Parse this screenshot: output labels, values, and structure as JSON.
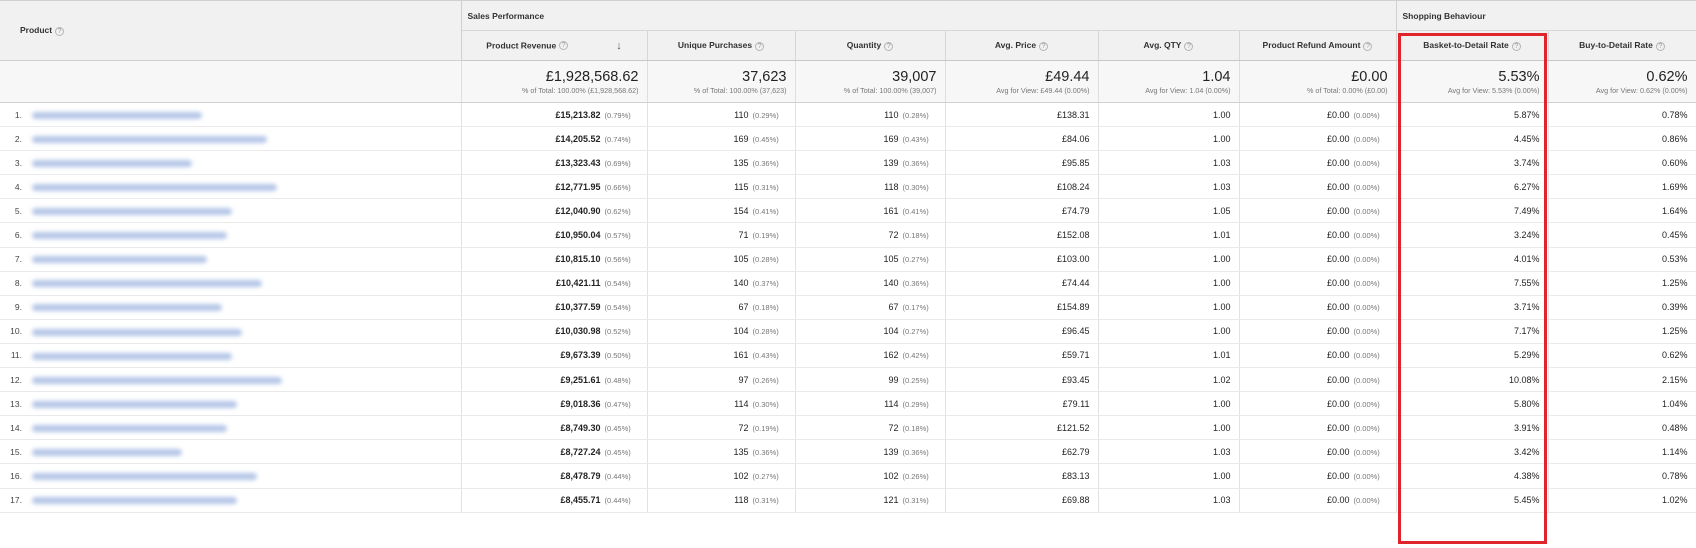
{
  "header": {
    "product_label": "Product",
    "group_sales": "Sales Performance",
    "group_shopping": "Shopping Behaviour",
    "columns": {
      "revenue": "Product Revenue",
      "unique": "Unique Purchases",
      "quantity": "Quantity",
      "avg_price": "Avg. Price",
      "avg_qty": "Avg. QTY",
      "refund": "Product Refund Amount",
      "b2d": "Basket-to-Detail Rate",
      "buy2d": "Buy-to-Detail Rate"
    }
  },
  "totals": {
    "revenue": {
      "value": "£1,928,568.62",
      "sub": "% of Total: 100.00% (£1,928,568.62)"
    },
    "unique": {
      "value": "37,623",
      "sub": "% of Total: 100.00% (37,623)"
    },
    "quantity": {
      "value": "39,007",
      "sub": "% of Total: 100.00% (39,007)"
    },
    "avg_price": {
      "value": "£49.44",
      "sub": "Avg for View: £49.44 (0.00%)"
    },
    "avg_qty": {
      "value": "1.04",
      "sub": "Avg for View: 1.04 (0.00%)"
    },
    "refund": {
      "value": "£0.00",
      "sub": "% of Total: 0.00% (£0.00)"
    },
    "b2d": {
      "value": "5.53%",
      "sub": "Avg for View: 5.53% (0.00%)"
    },
    "buy2d": {
      "value": "0.62%",
      "sub": "Avg for View: 0.62% (0.00%)"
    }
  },
  "rows": [
    {
      "idx": "1.",
      "revenue": "£15,213.82",
      "revenue_pct": "(0.79%)",
      "unique": "110",
      "unique_pct": "(0.29%)",
      "quantity": "110",
      "quantity_pct": "(0.28%)",
      "avg_price": "£138.31",
      "avg_qty": "1.00",
      "refund": "£0.00",
      "refund_pct": "(0.00%)",
      "b2d": "5.87%",
      "buy2d": "0.78%"
    },
    {
      "idx": "2.",
      "revenue": "£14,205.52",
      "revenue_pct": "(0.74%)",
      "unique": "169",
      "unique_pct": "(0.45%)",
      "quantity": "169",
      "quantity_pct": "(0.43%)",
      "avg_price": "£84.06",
      "avg_qty": "1.00",
      "refund": "£0.00",
      "refund_pct": "(0.00%)",
      "b2d": "4.45%",
      "buy2d": "0.86%"
    },
    {
      "idx": "3.",
      "revenue": "£13,323.43",
      "revenue_pct": "(0.69%)",
      "unique": "135",
      "unique_pct": "(0.36%)",
      "quantity": "139",
      "quantity_pct": "(0.36%)",
      "avg_price": "£95.85",
      "avg_qty": "1.03",
      "refund": "£0.00",
      "refund_pct": "(0.00%)",
      "b2d": "3.74%",
      "buy2d": "0.60%"
    },
    {
      "idx": "4.",
      "revenue": "£12,771.95",
      "revenue_pct": "(0.66%)",
      "unique": "115",
      "unique_pct": "(0.31%)",
      "quantity": "118",
      "quantity_pct": "(0.30%)",
      "avg_price": "£108.24",
      "avg_qty": "1.03",
      "refund": "£0.00",
      "refund_pct": "(0.00%)",
      "b2d": "6.27%",
      "buy2d": "1.69%"
    },
    {
      "idx": "5.",
      "revenue": "£12,040.90",
      "revenue_pct": "(0.62%)",
      "unique": "154",
      "unique_pct": "(0.41%)",
      "quantity": "161",
      "quantity_pct": "(0.41%)",
      "avg_price": "£74.79",
      "avg_qty": "1.05",
      "refund": "£0.00",
      "refund_pct": "(0.00%)",
      "b2d": "7.49%",
      "buy2d": "1.64%"
    },
    {
      "idx": "6.",
      "revenue": "£10,950.04",
      "revenue_pct": "(0.57%)",
      "unique": "71",
      "unique_pct": "(0.19%)",
      "quantity": "72",
      "quantity_pct": "(0.18%)",
      "avg_price": "£152.08",
      "avg_qty": "1.01",
      "refund": "£0.00",
      "refund_pct": "(0.00%)",
      "b2d": "3.24%",
      "buy2d": "0.45%"
    },
    {
      "idx": "7.",
      "revenue": "£10,815.10",
      "revenue_pct": "(0.56%)",
      "unique": "105",
      "unique_pct": "(0.28%)",
      "quantity": "105",
      "quantity_pct": "(0.27%)",
      "avg_price": "£103.00",
      "avg_qty": "1.00",
      "refund": "£0.00",
      "refund_pct": "(0.00%)",
      "b2d": "4.01%",
      "buy2d": "0.53%"
    },
    {
      "idx": "8.",
      "revenue": "£10,421.11",
      "revenue_pct": "(0.54%)",
      "unique": "140",
      "unique_pct": "(0.37%)",
      "quantity": "140",
      "quantity_pct": "(0.36%)",
      "avg_price": "£74.44",
      "avg_qty": "1.00",
      "refund": "£0.00",
      "refund_pct": "(0.00%)",
      "b2d": "7.55%",
      "buy2d": "1.25%"
    },
    {
      "idx": "9.",
      "revenue": "£10,377.59",
      "revenue_pct": "(0.54%)",
      "unique": "67",
      "unique_pct": "(0.18%)",
      "quantity": "67",
      "quantity_pct": "(0.17%)",
      "avg_price": "£154.89",
      "avg_qty": "1.00",
      "refund": "£0.00",
      "refund_pct": "(0.00%)",
      "b2d": "3.71%",
      "buy2d": "0.39%"
    },
    {
      "idx": "10.",
      "revenue": "£10,030.98",
      "revenue_pct": "(0.52%)",
      "unique": "104",
      "unique_pct": "(0.28%)",
      "quantity": "104",
      "quantity_pct": "(0.27%)",
      "avg_price": "£96.45",
      "avg_qty": "1.00",
      "refund": "£0.00",
      "refund_pct": "(0.00%)",
      "b2d": "7.17%",
      "buy2d": "1.25%"
    },
    {
      "idx": "11.",
      "revenue": "£9,673.39",
      "revenue_pct": "(0.50%)",
      "unique": "161",
      "unique_pct": "(0.43%)",
      "quantity": "162",
      "quantity_pct": "(0.42%)",
      "avg_price": "£59.71",
      "avg_qty": "1.01",
      "refund": "£0.00",
      "refund_pct": "(0.00%)",
      "b2d": "5.29%",
      "buy2d": "0.62%"
    },
    {
      "idx": "12.",
      "revenue": "£9,251.61",
      "revenue_pct": "(0.48%)",
      "unique": "97",
      "unique_pct": "(0.26%)",
      "quantity": "99",
      "quantity_pct": "(0.25%)",
      "avg_price": "£93.45",
      "avg_qty": "1.02",
      "refund": "£0.00",
      "refund_pct": "(0.00%)",
      "b2d": "10.08%",
      "buy2d": "2.15%"
    },
    {
      "idx": "13.",
      "revenue": "£9,018.36",
      "revenue_pct": "(0.47%)",
      "unique": "114",
      "unique_pct": "(0.30%)",
      "quantity": "114",
      "quantity_pct": "(0.29%)",
      "avg_price": "£79.11",
      "avg_qty": "1.00",
      "refund": "£0.00",
      "refund_pct": "(0.00%)",
      "b2d": "5.80%",
      "buy2d": "1.04%"
    },
    {
      "idx": "14.",
      "revenue": "£8,749.30",
      "revenue_pct": "(0.45%)",
      "unique": "72",
      "unique_pct": "(0.19%)",
      "quantity": "72",
      "quantity_pct": "(0.18%)",
      "avg_price": "£121.52",
      "avg_qty": "1.00",
      "refund": "£0.00",
      "refund_pct": "(0.00%)",
      "b2d": "3.91%",
      "buy2d": "0.48%"
    },
    {
      "idx": "15.",
      "revenue": "£8,727.24",
      "revenue_pct": "(0.45%)",
      "unique": "135",
      "unique_pct": "(0.36%)",
      "quantity": "139",
      "quantity_pct": "(0.36%)",
      "avg_price": "£62.79",
      "avg_qty": "1.03",
      "refund": "£0.00",
      "refund_pct": "(0.00%)",
      "b2d": "3.42%",
      "buy2d": "1.14%"
    },
    {
      "idx": "16.",
      "revenue": "£8,478.79",
      "revenue_pct": "(0.44%)",
      "unique": "102",
      "unique_pct": "(0.27%)",
      "quantity": "102",
      "quantity_pct": "(0.26%)",
      "avg_price": "£83.13",
      "avg_qty": "1.00",
      "refund": "£0.00",
      "refund_pct": "(0.00%)",
      "b2d": "4.38%",
      "buy2d": "0.78%"
    },
    {
      "idx": "17.",
      "revenue": "£8,455.71",
      "revenue_pct": "(0.44%)",
      "unique": "118",
      "unique_pct": "(0.31%)",
      "quantity": "121",
      "quantity_pct": "(0.31%)",
      "avg_price": "£69.88",
      "avg_qty": "1.03",
      "refund": "£0.00",
      "refund_pct": "(0.00%)",
      "b2d": "5.45%",
      "buy2d": "1.02%"
    }
  ],
  "colors": {
    "highlight": "#e0242c",
    "header_bg": "#f1f1f1",
    "blurred_link": "#a9bde3"
  },
  "icons": {
    "help": "question-circle-icon",
    "sort": "arrow-down-icon"
  }
}
